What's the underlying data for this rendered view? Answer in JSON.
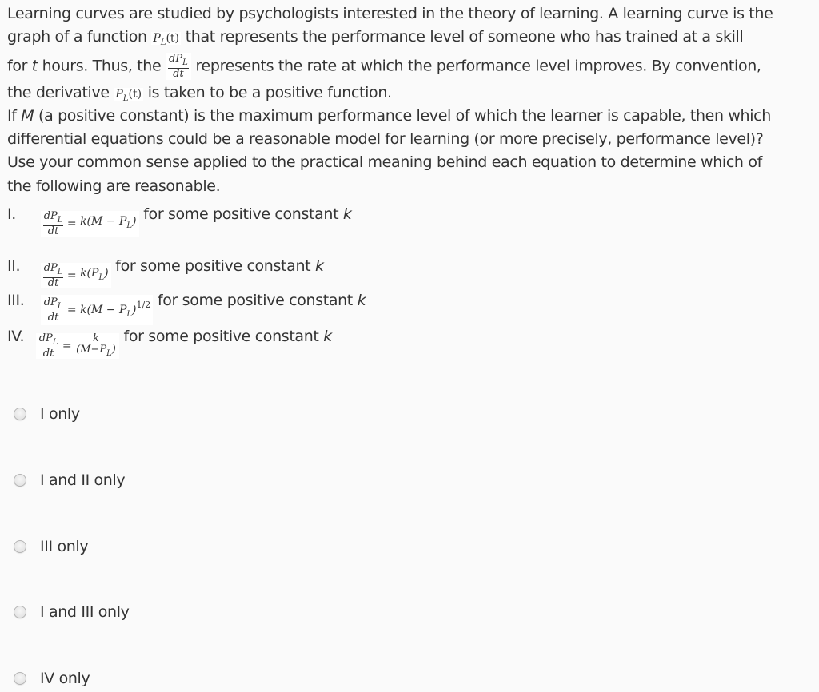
{
  "question": {
    "p1_line1": "Learning curves are studied by psychologists interested in the theory of learning. A learning curve is the",
    "p1_line2_a": "graph of a function",
    "p1_line2_b": "that represents the performance level of someone who has trained at a skill",
    "p1_line3_a": "for",
    "p1_line3_t": "t",
    "p1_line3_b": "hours. Thus, the",
    "p1_line3_c": "represents the rate at which the performance level improves. By convention,",
    "p1_line4_a": "the derivative",
    "p1_line4_b": "is taken to be a positive function.",
    "p2_line1_a": "If",
    "p2_line1_M": "M",
    "p2_line1_b": "(a positive constant) is the maximum performance level of which the learner is capable, then which",
    "p2_line2": "differential equations could be a reasonable model for learning (or more precisely, performance level)?",
    "p2_line3": "Use your common sense applied to the practical meaning behind each equation to determine which of",
    "p2_line4": "the following are reasonable."
  },
  "math": {
    "P": "P",
    "sub_L": "L",
    "arg_t": "(t)",
    "dP": "dP",
    "dt": "dt",
    "eq": "=",
    "k": "k",
    "half": "1/2"
  },
  "statements": [
    {
      "numeral": "I.",
      "rhs_pre": "k(M − P",
      "rhs_post": ")",
      "sup": "",
      "suffix": "for some positive constant",
      "const": "k"
    },
    {
      "numeral": "II.",
      "rhs_pre": "k(P",
      "rhs_post": ")",
      "sup": "",
      "suffix": "for some positive constant",
      "const": "k"
    },
    {
      "numeral": "III.",
      "rhs_pre": "k(M − P",
      "rhs_post": ")",
      "sup": "1/2",
      "suffix": "for some positive constant",
      "const": "k"
    },
    {
      "numeral": "IV.",
      "rhs_num": "k",
      "rhs_den_pre": "(M−P",
      "rhs_den_post": ")",
      "suffix": "for some positive constant",
      "const": "k"
    }
  ],
  "options": [
    {
      "label": "I only",
      "selected": false
    },
    {
      "label": "I and II only",
      "selected": false
    },
    {
      "label": "III only",
      "selected": false
    },
    {
      "label": "I and III only",
      "selected": false
    },
    {
      "label": "IV only",
      "selected": false
    }
  ]
}
